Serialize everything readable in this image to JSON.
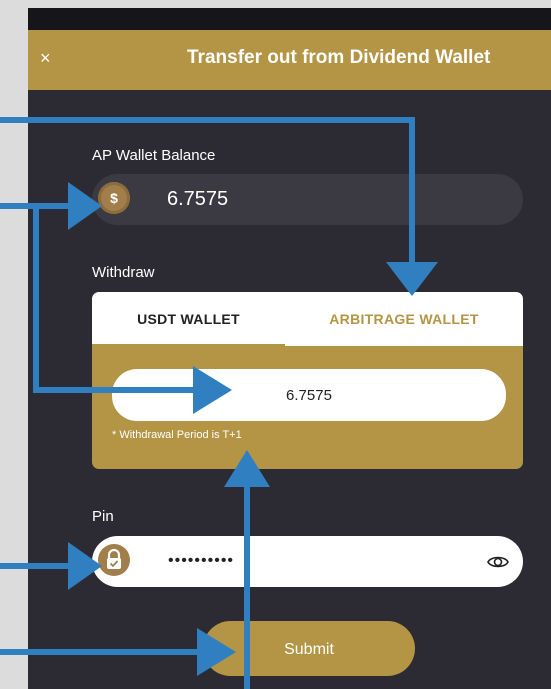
{
  "header": {
    "close_symbol": "×",
    "title": "Transfer out from Dividend Wallet"
  },
  "balance": {
    "label": "AP Wallet Balance",
    "value": "6.7575",
    "icon": "money-bag-icon"
  },
  "withdraw": {
    "label": "Withdraw",
    "tabs": [
      "USDT WALLET",
      "ARBITRAGE WALLET"
    ],
    "selected_tab": "USDT WALLET",
    "amount_value": "6.7575",
    "note": "* Withdrawal Period is T+1"
  },
  "pin": {
    "label": "Pin",
    "masked_value": "••••••••••",
    "lock_icon": "lock-icon",
    "toggle_icon": "eye-icon"
  },
  "submit_label": "Submit",
  "colors": {
    "accent": "#b39545",
    "panel": "#2c2b33",
    "field_dark": "#3b3a42",
    "annotation_arrow": "#2f7fc1"
  }
}
